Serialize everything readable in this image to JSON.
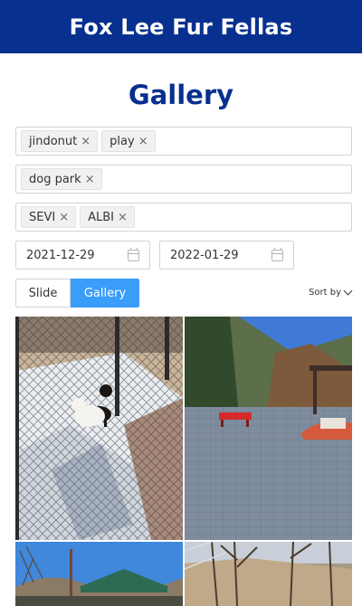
{
  "header": {
    "title": "Fox Lee Fur Fellas"
  },
  "page": {
    "title": "Gallery"
  },
  "filters": {
    "tag_rows": [
      {
        "tags": [
          "jindonut",
          "play"
        ]
      },
      {
        "tags": [
          "dog park"
        ]
      },
      {
        "tags": [
          "SEVI",
          "ALBI"
        ]
      }
    ],
    "tag_remove_glyph": "×",
    "date_start": "2021-12-29",
    "date_end": "2022-01-29"
  },
  "view_toggle": {
    "slide_label": "Slide",
    "gallery_label": "Gallery",
    "selected": "Gallery",
    "selected_color": "#3b9dfa"
  },
  "sort": {
    "label": "Sort by"
  },
  "gallery": {
    "photos": [
      {
        "icon": "photo-dogs-on-snow"
      },
      {
        "icon": "photo-paved-dog-park"
      },
      {
        "icon": "photo-park-pavilion"
      },
      {
        "icon": "photo-winter-trees"
      }
    ]
  },
  "colors": {
    "brand": "#08308f",
    "accent": "#3b9dfa"
  }
}
